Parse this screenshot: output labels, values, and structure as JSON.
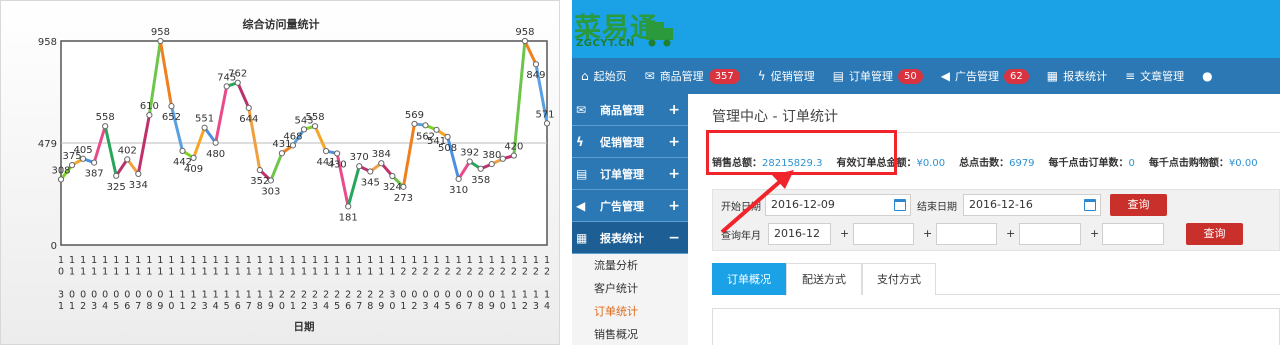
{
  "chart_data": {
    "type": "line",
    "title": "综合访问量统计",
    "xlabel": "日期",
    "ylabel": "",
    "ylim": [
      0,
      958
    ],
    "yticks": [
      "958",
      "479",
      "0"
    ],
    "grid": true,
    "categories": [
      "1\n0\n\n3\n1",
      "1\n1\n\n0\n1",
      "1\n1\n\n0\n2",
      "1\n1\n\n0\n3",
      "1\n1\n\n0\n4",
      "1\n1\n\n0\n5",
      "1\n1\n\n0\n6",
      "1\n1\n\n0\n7",
      "1\n1\n\n0\n8",
      "1\n1\n\n0\n9",
      "1\n1\n\n1\n0",
      "1\n1\n\n1\n1",
      "1\n1\n\n1\n2",
      "1\n1\n\n1\n3",
      "1\n1\n\n1\n4",
      "1\n1\n\n1\n5",
      "1\n1\n\n1\n6",
      "1\n1\n\n1\n7",
      "1\n1\n\n1\n8",
      "1\n1\n\n1\n9",
      "1\n1\n\n2\n0",
      "1\n1\n\n2\n1",
      "1\n1\n\n2\n2",
      "1\n1\n\n2\n3",
      "1\n1\n\n2\n4",
      "1\n1\n\n2\n5",
      "1\n1\n\n2\n6",
      "1\n1\n\n2\n7",
      "1\n1\n\n2\n8",
      "1\n1\n\n2\n9",
      "1\n1\n\n3\n0",
      "1\n2\n\n0\n1",
      "1\n2\n\n0\n2",
      "1\n2\n\n0\n3",
      "1\n2\n\n0\n4",
      "1\n2\n\n0\n5",
      "1\n2\n\n0\n6",
      "1\n2\n\n0\n7",
      "1\n2\n\n0\n8",
      "1\n2\n\n0\n9",
      "1\n2\n\n1\n0",
      "1\n2\n\n1\n1",
      "1\n2\n\n1\n2",
      "1\n2\n\n1\n3",
      "1\n2\n\n1\n4"
    ],
    "values": [
      308,
      375,
      405,
      387,
      558,
      325,
      402,
      334,
      610,
      958,
      652,
      442,
      409,
      551,
      480,
      745,
      762,
      644,
      352,
      303,
      431,
      468,
      543,
      558,
      441,
      430,
      181,
      370,
      345,
      384,
      324,
      273,
      569,
      562,
      541,
      508,
      310,
      392,
      358,
      380,
      405,
      420,
      958,
      849,
      571
    ],
    "labels": [
      "308",
      "375",
      "405",
      "387",
      "558",
      "325",
      "402",
      "334",
      "610",
      "958",
      "652",
      "442",
      "409",
      "551",
      "480",
      "745",
      "762",
      "644",
      "352",
      "303",
      "431",
      "468",
      "543",
      "558",
      "441",
      "430",
      "181",
      "370",
      "345",
      "384",
      "324",
      "273",
      "569",
      "562",
      "541",
      "508",
      "310",
      "392",
      "358",
      "380",
      "",
      "420",
      "958",
      "849",
      "571"
    ],
    "segment_colors": [
      "#7ed321",
      "#f5a623",
      "#4a90e2",
      "#e94b8a",
      "#26a65b",
      "#b8326e",
      "#f0a040",
      "#c0306a",
      "#6dc64a",
      "#f07f1e",
      "#5aa0e0"
    ]
  },
  "app": {
    "logo_text": "菜易通",
    "logo_sub": "ZGCYT.CN",
    "nav": [
      {
        "icon": "home-icon",
        "glyph": "⌂",
        "label": "起始页",
        "badge": ""
      },
      {
        "icon": "mail-icon",
        "glyph": "✉",
        "label": "商品管理",
        "badge": "357"
      },
      {
        "icon": "bolt-icon",
        "glyph": "ϟ",
        "label": "促销管理",
        "badge": ""
      },
      {
        "icon": "document-icon",
        "glyph": "▤",
        "label": "订单管理",
        "badge": "50"
      },
      {
        "icon": "speaker-icon",
        "glyph": "◀",
        "label": "广告管理",
        "badge": "62"
      },
      {
        "icon": "chart-icon",
        "glyph": "▦",
        "label": "报表统计",
        "badge": ""
      },
      {
        "icon": "list-icon",
        "glyph": "≡",
        "label": "文章管理",
        "badge": ""
      },
      {
        "icon": "user-icon",
        "glyph": "●",
        "label": "",
        "badge": ""
      }
    ],
    "sidebar": {
      "groups": [
        {
          "icon": "mail-icon",
          "glyph": "✉",
          "label": "商品管理",
          "toggle": "+"
        },
        {
          "icon": "bolt-icon",
          "glyph": "ϟ",
          "label": "促销管理",
          "toggle": "+"
        },
        {
          "icon": "document-icon",
          "glyph": "▤",
          "label": "订单管理",
          "toggle": "+"
        },
        {
          "icon": "speaker-icon",
          "glyph": "◀",
          "label": "广告管理",
          "toggle": "+"
        },
        {
          "icon": "chart-icon",
          "glyph": "▦",
          "label": "报表统计",
          "toggle": "−"
        }
      ],
      "subitems": [
        "流量分析",
        "客户统计",
        "订单统计",
        "销售概况"
      ]
    },
    "breadcrumb": "管理中心  -  订单统计",
    "summary": [
      {
        "label": "销售总额：",
        "value": "28215829.3"
      },
      {
        "label": "有效订单总金额：",
        "value": "¥0.00"
      },
      {
        "label": "总点击数：",
        "value": "6979"
      },
      {
        "label": "每千点击订单数：",
        "value": "0"
      },
      {
        "label": "每千点击购物额：",
        "value": "¥0.00"
      }
    ],
    "filter": {
      "start_label": "开始日期",
      "start_value": "2016-12-09",
      "end_label": "结束日期",
      "end_value": "2016-12-16",
      "query_label": "查询",
      "year_month_label": "查询年月",
      "year_month_value": "2016-12",
      "plus": "+",
      "query2_label": "查询"
    },
    "tabs": [
      "订单概况",
      "配送方式",
      "支付方式"
    ]
  }
}
